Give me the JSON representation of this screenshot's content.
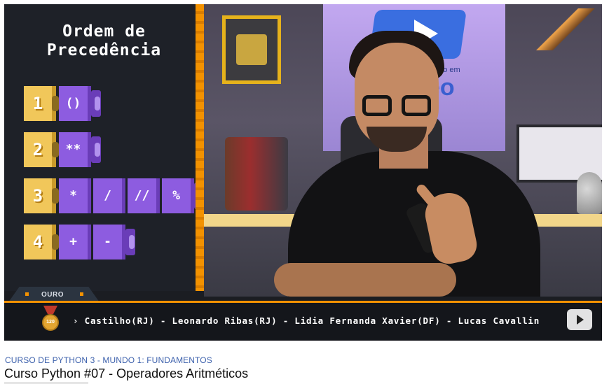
{
  "slide": {
    "title_line1": "Ordem de",
    "title_line2": "Precedência",
    "rows": [
      {
        "number": "1",
        "operators": [
          "()"
        ]
      },
      {
        "number": "2",
        "operators": [
          "**"
        ]
      },
      {
        "number": "3",
        "operators": [
          "*",
          "/",
          "//",
          "%"
        ]
      },
      {
        "number": "4",
        "operators": [
          "+",
          "-"
        ]
      }
    ]
  },
  "scene": {
    "logo_small": "Curso em",
    "logo_big": "eo"
  },
  "ticker": {
    "tab_label": "OURO",
    "medal_label": "120",
    "text": "› Castilho(RJ) - Leonardo Ribas(RJ) - Lidia Fernanda Xavier(DF) - Lucas Cavallin"
  },
  "meta": {
    "series": "CURSO DE PYTHON 3 - MUNDO 1: FUNDAMENTOS",
    "title": "Curso Python #07 - Operadores Aritméticos"
  },
  "colors": {
    "accent_orange": "#f39200",
    "block_yellow": "#f1c75a",
    "block_purple": "#8d5ce0",
    "link_blue": "#3e62ad"
  },
  "icons": {
    "next": "next-arrow-icon",
    "medal": "medal-icon"
  }
}
